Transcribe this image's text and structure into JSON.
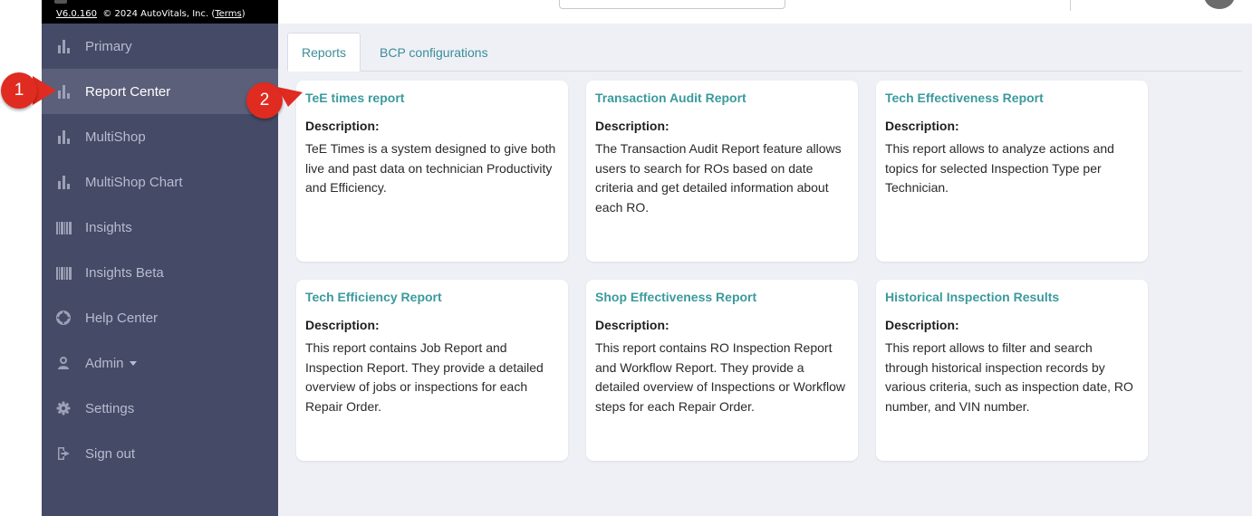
{
  "app": {
    "version": "V6.0.160",
    "copyright": "© 2024 AutoVitals, Inc. (",
    "terms": "Terms",
    "copyright_end": ")"
  },
  "sidebar": {
    "items": [
      {
        "label": "Primary",
        "icon": "bar-chart-icon"
      },
      {
        "label": "Report Center",
        "icon": "bar-chart-icon",
        "active": true
      },
      {
        "label": "MultiShop",
        "icon": "bar-chart-icon"
      },
      {
        "label": "MultiShop Chart",
        "icon": "bar-chart-icon"
      },
      {
        "label": "Insights",
        "icon": "barcode-icon"
      },
      {
        "label": "Insights Beta",
        "icon": "barcode-icon"
      },
      {
        "label": "Help Center",
        "icon": "lifebuoy-icon"
      },
      {
        "label": "Admin",
        "icon": "user-icon"
      },
      {
        "label": "Settings",
        "icon": "gear-icon"
      },
      {
        "label": "Sign out",
        "icon": "sign-out-icon"
      }
    ]
  },
  "tabs": [
    {
      "label": "Reports",
      "active": true
    },
    {
      "label": "BCP configurations",
      "active": false
    }
  ],
  "cards": [
    {
      "title": "TeE times report",
      "desc_label": "Description:",
      "desc": "TeE Times is a system designed to give both live and past data on technician Productivity and Efficiency."
    },
    {
      "title": "Transaction Audit Report",
      "desc_label": "Description:",
      "desc": "The Transaction Audit Report feature allows users to search for ROs based on date criteria and get detailed information about each RO."
    },
    {
      "title": "Tech Effectiveness Report",
      "desc_label": "Description:",
      "desc": "This report allows to analyze actions and topics for selected Inspection Type per Technician."
    },
    {
      "title": "Tech Efficiency Report",
      "desc_label": "Description:",
      "desc": "This report contains Job Report and Inspection Report. They provide a detailed overview of jobs or inspections for each Repair Order."
    },
    {
      "title": "Shop Effectiveness Report",
      "desc_label": "Description:",
      "desc": "This report contains RO Inspection Report and Workflow Report. They provide a detailed overview of Inspections or Workflow steps for each Repair Order."
    },
    {
      "title": "Historical Inspection Results",
      "desc_label": "Description:",
      "desc": "This report allows to filter and search through historical inspection records by various criteria, such as inspection date, RO number, and VIN number."
    }
  ],
  "markers": [
    {
      "number": "1"
    },
    {
      "number": "2"
    }
  ],
  "colors": {
    "sidebar_bg": "#454a66",
    "sidebar_active": "#5b5f79",
    "accent_teal": "#3b9a9d",
    "content_bg": "#eef0f6",
    "marker_red": "#e02b20"
  }
}
